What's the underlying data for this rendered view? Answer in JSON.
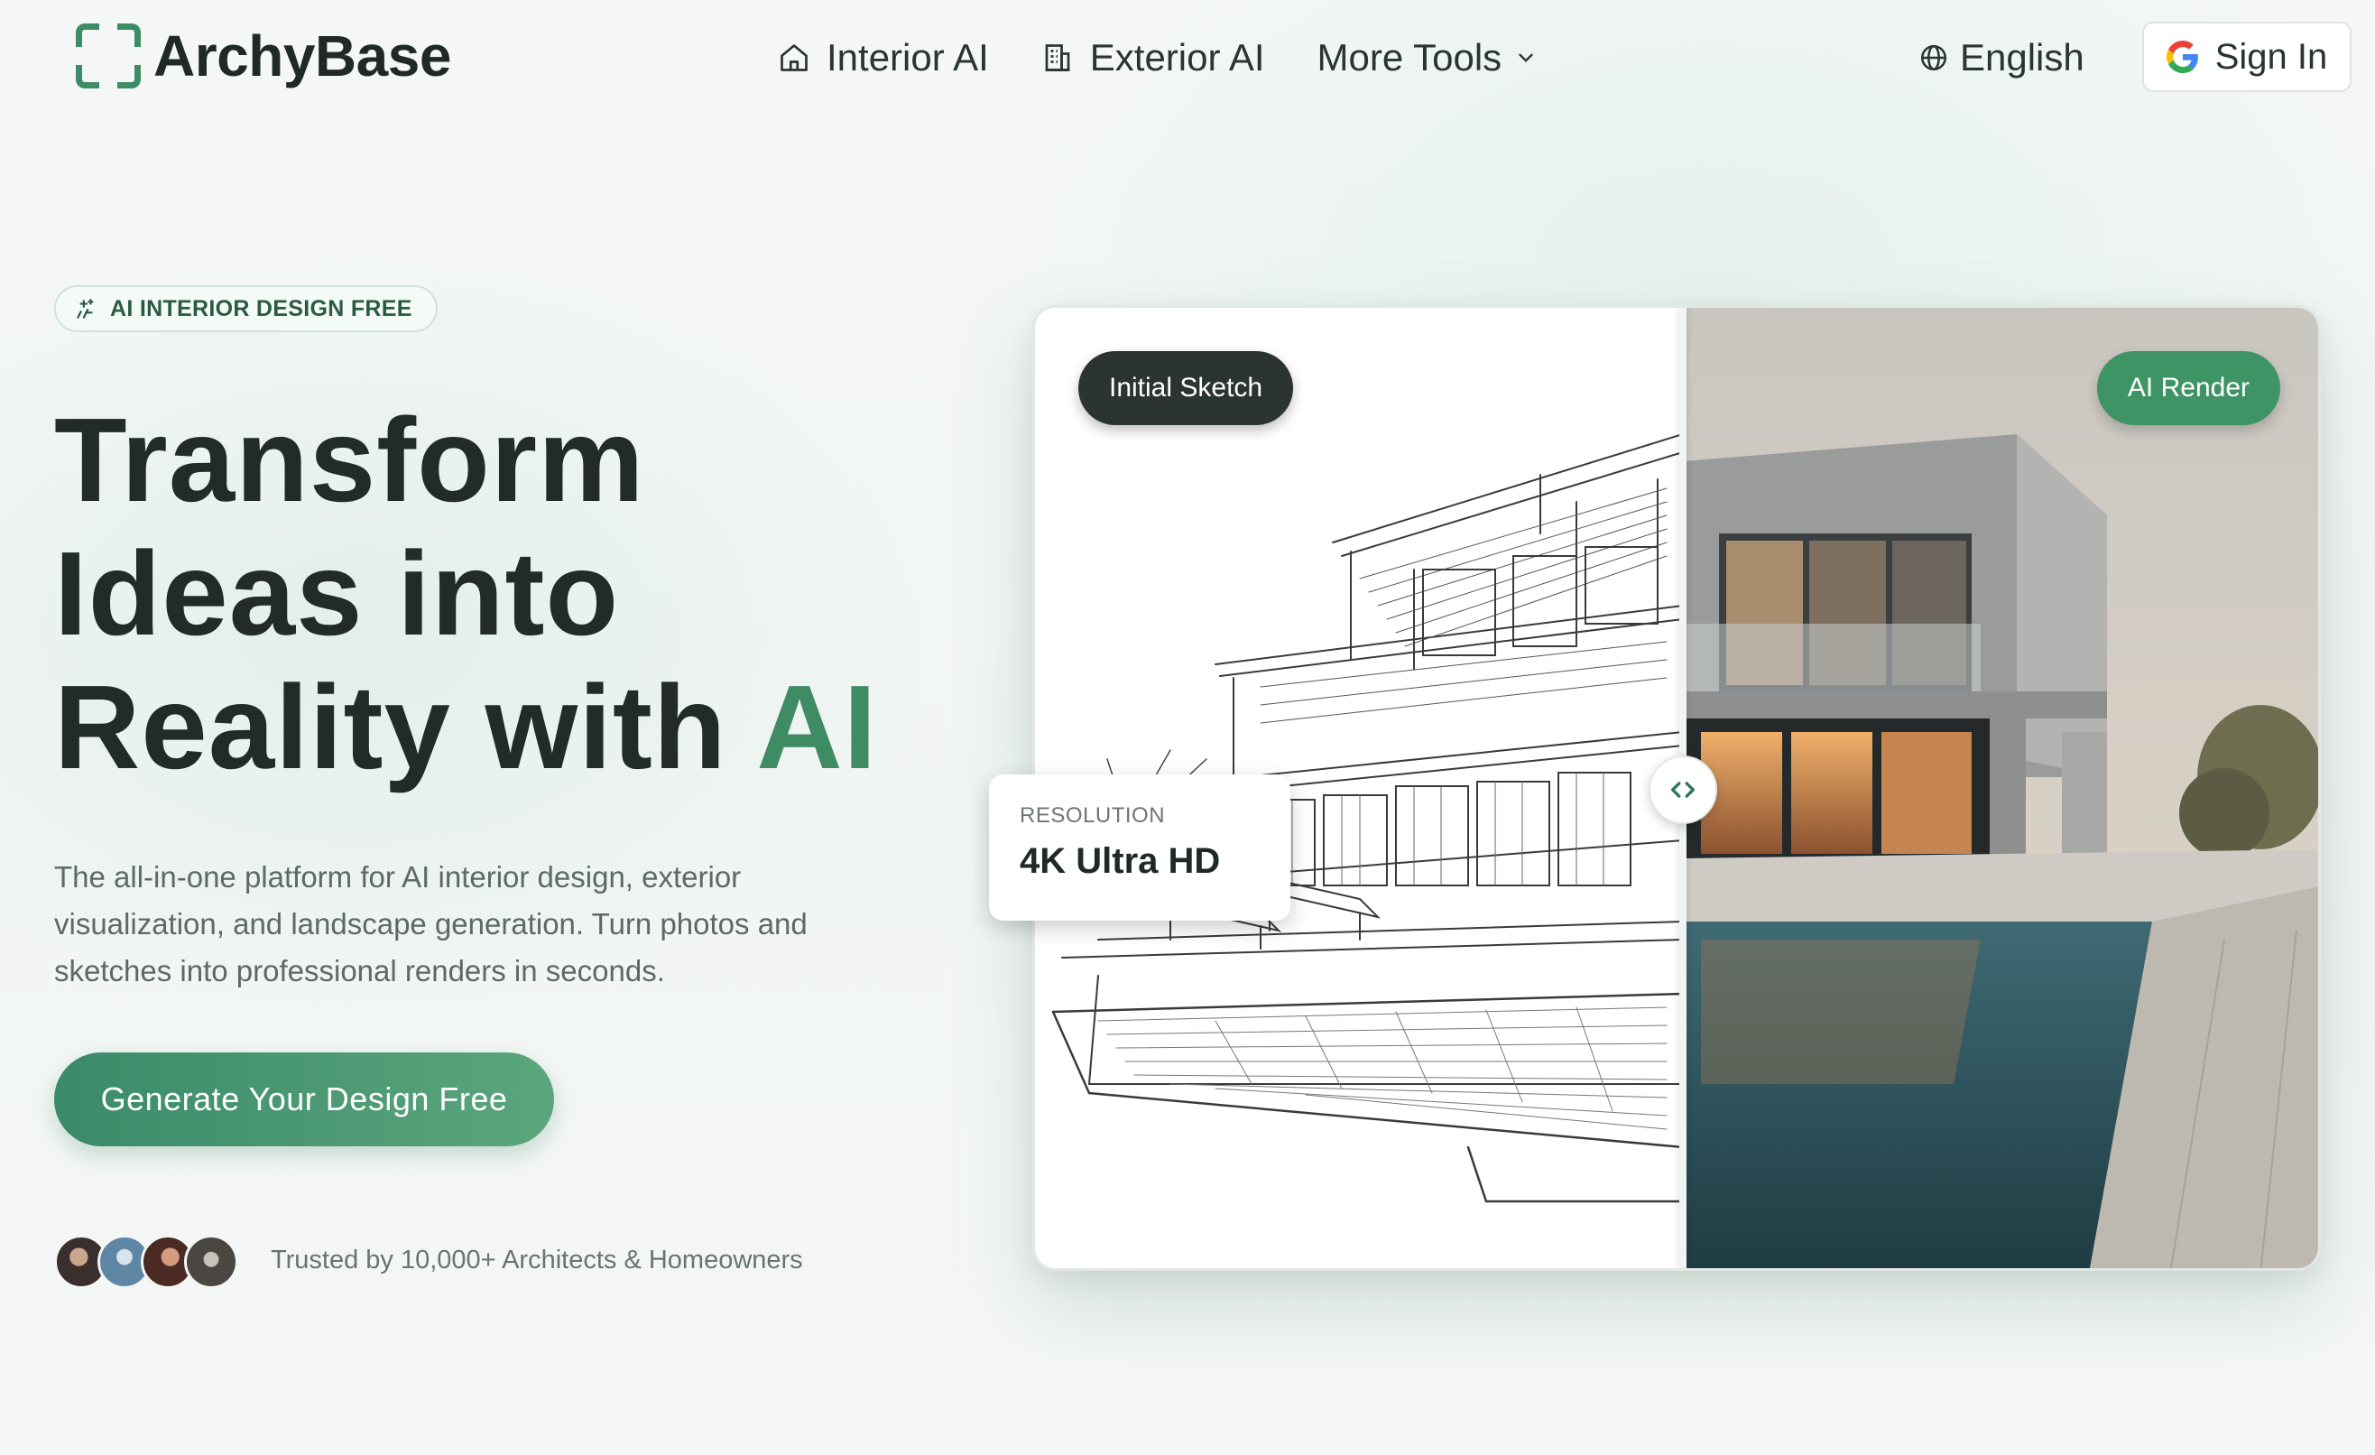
{
  "header": {
    "brand": "ArchyBase",
    "nav": [
      {
        "label": "Interior AI",
        "icon": "home-icon"
      },
      {
        "label": "Exterior AI",
        "icon": "building-icon"
      },
      {
        "label": "More Tools",
        "icon": "chevron-down-icon"
      }
    ],
    "language": "English",
    "signin_label": "Sign In"
  },
  "hero": {
    "badge": "AI INTERIOR DESIGN FREE",
    "headline_line1": "Transform",
    "headline_line2": "Ideas into",
    "headline_line3_prefix": "Reality with ",
    "headline_accent": "AI",
    "subtext": "The all-in-one platform for AI interior design, exterior visualization, and landscape generation. Turn photos and sketches into professional renders in seconds.",
    "cta_label": "Generate Your Design Free",
    "trusted_text": "Trusted by 10,000+ Architects & Homeowners"
  },
  "compare": {
    "left_label": "Initial Sketch",
    "right_label": "AI Render",
    "resolution_label": "RESOLUTION",
    "resolution_value": "4K Ultra HD"
  },
  "colors": {
    "brand_green": "#3f8b63",
    "cta_start": "#3a8a6a",
    "cta_end": "#5ba67c",
    "dark_text": "#222b27"
  }
}
